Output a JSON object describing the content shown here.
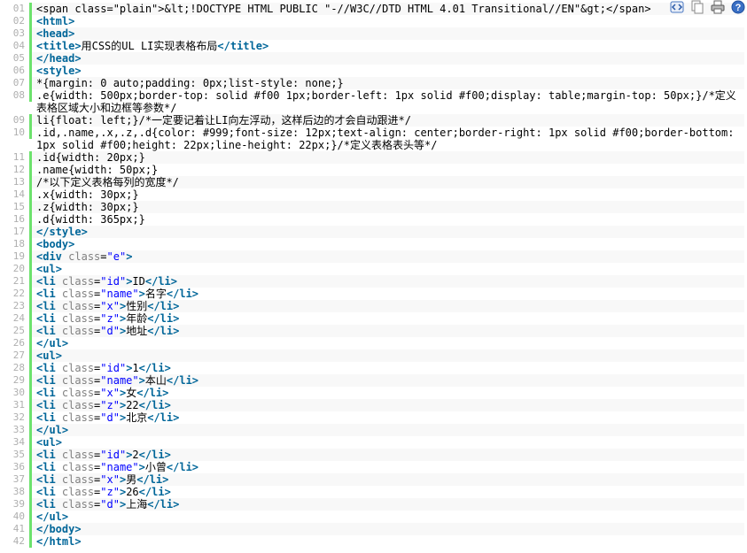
{
  "toolbar": {
    "icons": [
      "view-source-icon",
      "copy-icon",
      "print-icon",
      "help-icon"
    ]
  },
  "lines": [
    {
      "n": "01",
      "t": "<!DOCTYPE HTML PUBLIC \"-//W3C//DTD HTML 4.01 Transitional//EN\">"
    },
    {
      "n": "02",
      "t": "<html>"
    },
    {
      "n": "03",
      "t": "<head>"
    },
    {
      "n": "04",
      "t": "<title>用CSS的UL LI实现表格布局</title>"
    },
    {
      "n": "05",
      "t": "</head>"
    },
    {
      "n": "06",
      "t": "<style>"
    },
    {
      "n": "07",
      "t": "*{margin: 0 auto;padding: 0px;list-style: none;}"
    },
    {
      "n": "08",
      "t": ".e{width: 500px;border-top: solid #f00 1px;border-left: 1px solid #f00;display: table;margin-top: 50px;}/*定义表格区域大小和边框等参数*/"
    },
    {
      "n": "09",
      "t": "li{float: left;}/*一定要记着让LI向左浮动，这样后边的才会自动跟进*/"
    },
    {
      "n": "10",
      "t": ".id,.name,.x,.z,.d{color: #999;font-size: 12px;text-align: center;border-right: 1px solid #f00;border-bottom: 1px solid #f00;height: 22px;line-height: 22px;}/*定义表格表头等*/"
    },
    {
      "n": "11",
      "t": ".id{width: 20px;}"
    },
    {
      "n": "12",
      "t": ".name{width: 50px;}"
    },
    {
      "n": "13",
      "t": "/*以下定义表格每列的宽度*/"
    },
    {
      "n": "14",
      "t": ".x{width: 30px;}"
    },
    {
      "n": "15",
      "t": ".z{width: 30px;}"
    },
    {
      "n": "16",
      "t": ".d{width: 365px;}"
    },
    {
      "n": "17",
      "t": "</style>"
    },
    {
      "n": "18",
      "t": "<body>"
    },
    {
      "n": "19",
      "t": "<div class=\"e\">"
    },
    {
      "n": "20",
      "t": "<ul>"
    },
    {
      "n": "21",
      "t": "<li class=\"id\">ID</li>"
    },
    {
      "n": "22",
      "t": "<li class=\"name\">名字</li>"
    },
    {
      "n": "23",
      "t": "<li class=\"x\">性别</li>"
    },
    {
      "n": "24",
      "t": "<li class=\"z\">年龄</li>"
    },
    {
      "n": "25",
      "t": "<li class=\"d\">地址</li>"
    },
    {
      "n": "26",
      "t": "</ul>"
    },
    {
      "n": "27",
      "t": "<ul>"
    },
    {
      "n": "28",
      "t": "<li class=\"id\">1</li>"
    },
    {
      "n": "29",
      "t": "<li class=\"name\">本山</li>"
    },
    {
      "n": "30",
      "t": "<li class=\"x\">女</li>"
    },
    {
      "n": "31",
      "t": "<li class=\"z\">22</li>"
    },
    {
      "n": "32",
      "t": "<li class=\"d\">北京</li>"
    },
    {
      "n": "33",
      "t": "</ul>"
    },
    {
      "n": "34",
      "t": "<ul>"
    },
    {
      "n": "35",
      "t": "<li class=\"id\">2</li>"
    },
    {
      "n": "36",
      "t": "<li class=\"name\">小曾</li>"
    },
    {
      "n": "37",
      "t": "<li class=\"x\">男</li>"
    },
    {
      "n": "38",
      "t": "<li class=\"z\">26</li>"
    },
    {
      "n": "39",
      "t": "<li class=\"d\">上海</li>"
    },
    {
      "n": "40",
      "t": "</ul>"
    },
    {
      "n": "41",
      "t": "</body>"
    },
    {
      "n": "42",
      "t": "</html>"
    }
  ],
  "colors": {
    "gutter_border": "#6ce26c",
    "line_number": "#afafaf",
    "keyword": "#006699",
    "attribute": "#808080",
    "string": "#0000ff"
  }
}
